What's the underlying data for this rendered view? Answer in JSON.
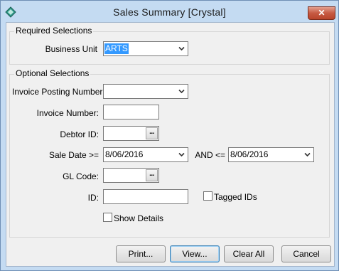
{
  "window": {
    "title": "Sales Summary  [Crystal]",
    "close_label": "✕"
  },
  "required_group": {
    "legend": "Required Selections",
    "business_unit_label": "Business Unit",
    "business_unit_value": "ARTS"
  },
  "optional_group": {
    "legend": "Optional Selections",
    "invoice_posting_number_label": "Invoice Posting Number:",
    "invoice_posting_number_value": "",
    "invoice_number_label": "Invoice Number:",
    "invoice_number_value": "",
    "debtor_id_label": "Debtor ID:",
    "debtor_id_value": "",
    "sale_date_from_label": "Sale Date >=",
    "sale_date_from_value": "8/06/2016",
    "sale_date_to_label": "AND <=",
    "sale_date_to_value": "8/06/2016",
    "gl_code_label": "GL Code:",
    "gl_code_value": "",
    "id_label": "ID:",
    "id_value": "",
    "tagged_ids_label": "Tagged IDs",
    "show_details_label": "Show Details",
    "ellipsis": "..."
  },
  "buttons": {
    "print": "Print...",
    "view": "View...",
    "clear_all": "Clear All",
    "cancel": "Cancel"
  }
}
